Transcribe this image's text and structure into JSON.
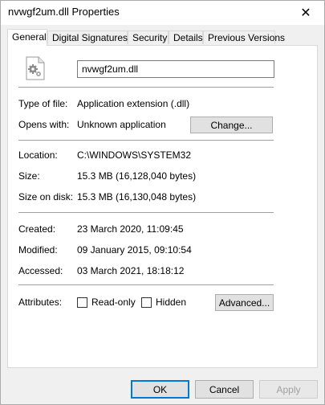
{
  "window": {
    "title": "nvwgf2um.dll Properties",
    "close_glyph": "✕"
  },
  "tabs": [
    {
      "label": "General",
      "active": true
    },
    {
      "label": "Digital Signatures",
      "active": false
    },
    {
      "label": "Security",
      "active": false
    },
    {
      "label": "Details",
      "active": false
    },
    {
      "label": "Previous Versions",
      "active": false
    }
  ],
  "general": {
    "file_icon": "dll-gear-file-icon",
    "file_name": "nvwgf2um.dll",
    "type_label": "Type of file:",
    "type_value": "Application extension (.dll)",
    "opens_label": "Opens with:",
    "opens_value": "Unknown application",
    "change_button": "Change...",
    "location_label": "Location:",
    "location_value": "C:\\WINDOWS\\SYSTEM32",
    "size_label": "Size:",
    "size_value": "15.3 MB (16,128,040 bytes)",
    "size_on_disk_label": "Size on disk:",
    "size_on_disk_value": "15.3 MB (16,130,048 bytes)",
    "created_label": "Created:",
    "created_value": "23 March 2020, 11:09:45",
    "modified_label": "Modified:",
    "modified_value": "09 January 2015, 09:10:54",
    "accessed_label": "Accessed:",
    "accessed_value": "03 March 2021, 18:18:12",
    "attributes_label": "Attributes:",
    "readonly_label": "Read-only",
    "readonly_checked": false,
    "hidden_label": "Hidden",
    "hidden_checked": false,
    "advanced_button": "Advanced..."
  },
  "footer": {
    "ok_label": "OK",
    "cancel_label": "Cancel",
    "apply_label": "Apply",
    "apply_enabled": false
  },
  "colors": {
    "accent": "#0078d7"
  }
}
